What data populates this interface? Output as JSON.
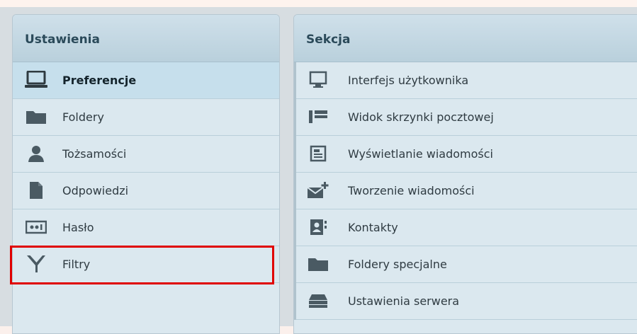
{
  "left_panel": {
    "title": "Ustawienia",
    "items": [
      {
        "label": "Preferencje",
        "icon": "laptop-icon",
        "selected": true
      },
      {
        "label": "Foldery",
        "icon": "folder-icon"
      },
      {
        "label": "Tożsamości",
        "icon": "user-icon"
      },
      {
        "label": "Odpowiedzi",
        "icon": "document-icon"
      },
      {
        "label": "Hasło",
        "icon": "password-icon"
      },
      {
        "label": "Filtry",
        "icon": "filter-icon"
      }
    ]
  },
  "right_panel": {
    "title": "Sekcja",
    "items": [
      {
        "label": "Interfejs użytkownika",
        "icon": "monitor-icon"
      },
      {
        "label": "Widok skrzynki pocztowej",
        "icon": "mailbox-view-icon"
      },
      {
        "label": "Wyświetlanie wiadomości",
        "icon": "message-display-icon"
      },
      {
        "label": "Tworzenie wiadomości",
        "icon": "compose-mail-icon"
      },
      {
        "label": "Kontakty",
        "icon": "contacts-icon"
      },
      {
        "label": "Foldery specjalne",
        "icon": "folder-icon"
      },
      {
        "label": "Ustawienia serwera",
        "icon": "server-icon"
      }
    ]
  },
  "colors": {
    "highlight": "#e00000",
    "icon": "#4a5a63"
  }
}
